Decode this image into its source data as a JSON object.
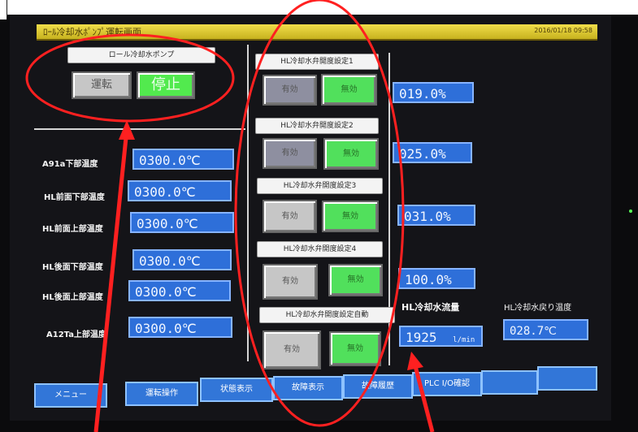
{
  "window": {
    "title": "ﾛｰﾙ冷却水ﾎﾟﾝﾌﾟ運転画面",
    "date": "2016/01/18 09:58"
  },
  "pump": {
    "label": "ロール冷却水ポンプ",
    "run": "運転",
    "stop": "停止"
  },
  "sensors": [
    {
      "label": "A91a下部温度",
      "value": "0300.0℃"
    },
    {
      "label": "HL前面下部温度",
      "value": "0300.0℃"
    },
    {
      "label": "HL前面上部温度",
      "value": "0300.0℃"
    },
    {
      "label": "HL後面下部温度",
      "value": "0300.0℃"
    },
    {
      "label": "HL後面上部温度",
      "value": "0300.0℃"
    },
    {
      "label": "A12Ta上部温度",
      "value": "0300.0℃"
    }
  ],
  "valves": [
    {
      "label": "HL冷却水弁開度設定1",
      "enabled": "有効",
      "disabled": "無効",
      "value": "019.0%"
    },
    {
      "label": "HL冷却水弁開度設定2",
      "enabled": "有効",
      "disabled": "無効",
      "value": "025.0%"
    },
    {
      "label": "HL冷却水弁開度設定3",
      "enabled": "有効",
      "disabled": "無効",
      "value": "031.0%"
    },
    {
      "label": "HL冷却水弁開度設定4",
      "enabled": "有効",
      "disabled": "無効",
      "value": "100.0%"
    },
    {
      "label": "HL冷却水弁開度設定自動",
      "enabled": "有効",
      "disabled": "無効"
    }
  ],
  "flow": {
    "label": "HL冷却水流量",
    "value": "1925",
    "unit": "l/min"
  },
  "return_temp": {
    "label": "HL冷却水戻り温度",
    "value": "028.7℃"
  },
  "nav": [
    {
      "label": "メニュー"
    },
    {
      "label": "運転操作"
    },
    {
      "label": "状態表示"
    },
    {
      "label": "故障表示"
    },
    {
      "label": "故障履歴"
    },
    {
      "label": "PLC I/O確認"
    },
    {
      "label": ""
    },
    {
      "label": ""
    }
  ],
  "colors": {
    "annotation": "#ff2020",
    "value_box": "#2e6fd9",
    "green": "#52ea4e",
    "title_yellow": "#f1de4a"
  }
}
